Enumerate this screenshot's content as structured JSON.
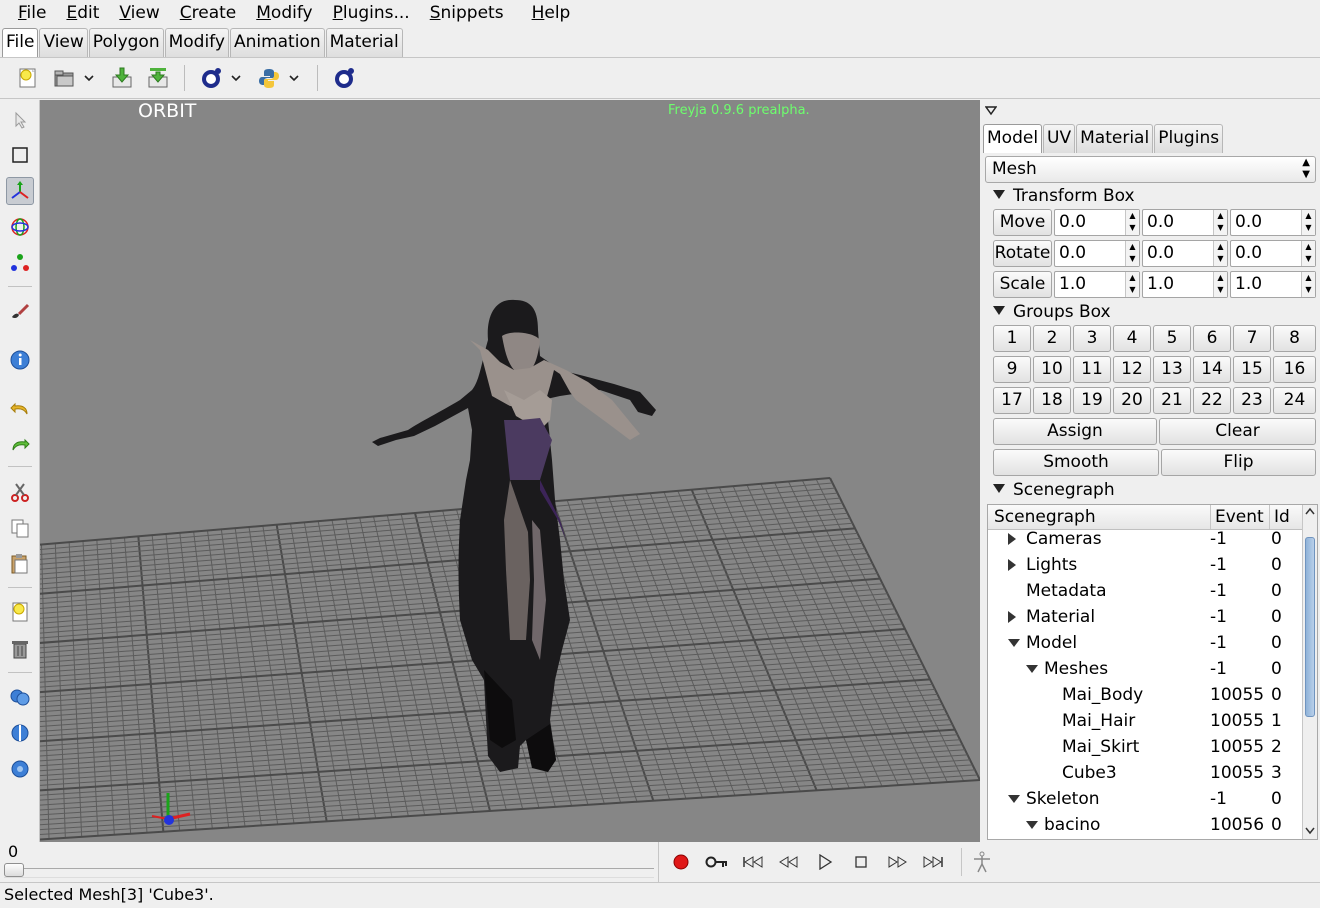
{
  "menubar": {
    "items": [
      "File",
      "Edit",
      "View",
      "Create",
      "Modify",
      "Plugins...",
      "Snippets",
      "Help"
    ]
  },
  "mode_tabs": {
    "items": [
      "File",
      "View",
      "Polygon",
      "Modify",
      "Animation",
      "Material"
    ],
    "active": "File"
  },
  "toolbar": {
    "icons": [
      "new-file-icon",
      "open-folder-icon",
      "import-icon",
      "export-icon",
      "lua-script-icon",
      "python-script-icon",
      "lua-console-icon"
    ]
  },
  "viewport": {
    "mode_label": "ORBIT",
    "version_label": "Freyja 0.9.6 prealpha."
  },
  "panel": {
    "tabs": [
      "Model",
      "UV",
      "Material",
      "Plugins"
    ],
    "active_tab": "Model",
    "mesh_select": "Mesh",
    "transform_box": {
      "title": "Transform Box",
      "rows": [
        {
          "label": "Move",
          "values": [
            "0.0",
            "0.0",
            "0.0"
          ]
        },
        {
          "label": "Rotate",
          "values": [
            "0.0",
            "0.0",
            "0.0"
          ]
        },
        {
          "label": "Scale",
          "values": [
            "1.0",
            "1.0",
            "1.0"
          ]
        }
      ]
    },
    "groups_box": {
      "title": "Groups Box",
      "groups": [
        "1",
        "2",
        "3",
        "4",
        "5",
        "6",
        "7",
        "8",
        "9",
        "10",
        "11",
        "12",
        "13",
        "14",
        "15",
        "16",
        "17",
        "18",
        "19",
        "20",
        "21",
        "22",
        "23",
        "24"
      ],
      "assign": "Assign",
      "clear": "Clear",
      "smooth": "Smooth",
      "flip": "Flip"
    },
    "scenegraph": {
      "title": "Scenegraph",
      "columns": [
        "Scenegraph",
        "Event",
        "Id"
      ],
      "rows": [
        {
          "name": "Cameras",
          "event": "-1",
          "id": "0",
          "depth": 1,
          "twisty": "closed"
        },
        {
          "name": "Lights",
          "event": "-1",
          "id": "0",
          "depth": 1,
          "twisty": "closed"
        },
        {
          "name": "Metadata",
          "event": "-1",
          "id": "0",
          "depth": 1,
          "twisty": "none"
        },
        {
          "name": "Material",
          "event": "-1",
          "id": "0",
          "depth": 1,
          "twisty": "closed"
        },
        {
          "name": "Model",
          "event": "-1",
          "id": "0",
          "depth": 1,
          "twisty": "open"
        },
        {
          "name": "Meshes",
          "event": "-1",
          "id": "0",
          "depth": 2,
          "twisty": "open"
        },
        {
          "name": "Mai_Body",
          "event": "10055",
          "id": "0",
          "depth": 3,
          "twisty": "none"
        },
        {
          "name": "Mai_Hair",
          "event": "10055",
          "id": "1",
          "depth": 3,
          "twisty": "none"
        },
        {
          "name": "Mai_Skirt",
          "event": "10055",
          "id": "2",
          "depth": 3,
          "twisty": "none"
        },
        {
          "name": "Cube3",
          "event": "10055",
          "id": "3",
          "depth": 3,
          "twisty": "none"
        },
        {
          "name": "Skeleton",
          "event": "-1",
          "id": "0",
          "depth": 1,
          "twisty": "open"
        },
        {
          "name": "bacino",
          "event": "10056",
          "id": "0",
          "depth": 2,
          "twisty": "open"
        }
      ]
    }
  },
  "timeline": {
    "frame": "0"
  },
  "status": {
    "text": "Selected Mesh[3] 'Cube3'."
  },
  "colors": {
    "viewport_bg": "#868686",
    "grid": "#5c5c5c",
    "version_text": "#6dff6d",
    "record": "#e01818"
  }
}
